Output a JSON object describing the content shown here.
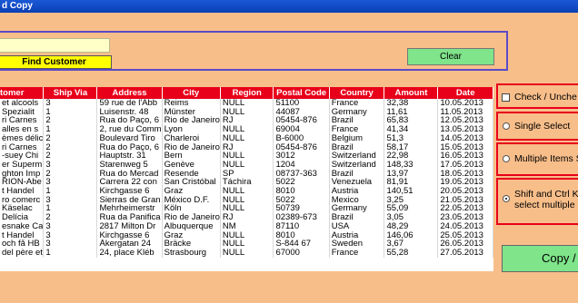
{
  "window": {
    "title": "d Copy"
  },
  "search": {
    "value": "",
    "find_label": "Find Customer",
    "clear_label": "Clear"
  },
  "table": {
    "headers": [
      "tomer",
      "Ship Via",
      "Address",
      "City",
      "Region",
      "Postal Code",
      "Country",
      "Amount",
      "Date"
    ],
    "rows": [
      [
        "et alcools",
        "3",
        "59 rue de l'Abb",
        "Reims",
        "NULL",
        "51100",
        "France",
        "32,38",
        "10.05.2013"
      ],
      [
        "Spezialit",
        "1",
        "Luisenstr. 48",
        "Münster",
        "NULL",
        "44087",
        "Germany",
        "11,61",
        "11.05.2013"
      ],
      [
        "ri Carnes",
        "2",
        "Rua do Paço, 6",
        "Rio de Janeiro",
        "RJ",
        "05454-876",
        "Brazil",
        "65,83",
        "12.05.2013"
      ],
      [
        "alles en s",
        "1",
        "2, rue du Comm",
        "Lyon",
        "NULL",
        "69004",
        "France",
        "41,34",
        "13.05.2013"
      ],
      [
        "èmes délic",
        "2",
        "Boulevard Tiro",
        "Charleroi",
        "NULL",
        "B-6000",
        "Belgium",
        "51,3",
        "14.05.2013"
      ],
      [
        "ri Carnes",
        "2",
        "Rua do Paço, 6",
        "Rio de Janeiro",
        "RJ",
        "05454-876",
        "Brazil",
        "58,17",
        "15.05.2013"
      ],
      [
        "-suey Chi",
        "2",
        "Hauptstr. 31",
        "Bern",
        "NULL",
        "3012",
        "Switzerland",
        "22,98",
        "16.05.2013"
      ],
      [
        "er Superm",
        "3",
        "Starenweg 5",
        "Genève",
        "NULL",
        "1204",
        "Switzerland",
        "148,33",
        "17.05.2013"
      ],
      [
        "ghton Imp",
        "2",
        "Rua do Mercad",
        "Resende",
        "SP",
        "08737-363",
        "Brazil",
        "13,97",
        "18.05.2013"
      ],
      [
        "RION-Abe",
        "3",
        "Carrera 22 con",
        "San Cristóbal",
        "Táchira",
        "5022",
        "Venezuela",
        "81,91",
        "19.05.2013"
      ],
      [
        "t Handel",
        "1",
        "Kirchgasse 6",
        "Graz",
        "NULL",
        "8010",
        "Austria",
        "140,51",
        "20.05.2013"
      ],
      [
        "ro comerc",
        "3",
        "Sierras de Gran",
        "México D.F.",
        "NULL",
        "5022",
        "Mexico",
        "3,25",
        "21.05.2013"
      ],
      [
        "Käselac",
        "1",
        "Mehrheimerstr",
        "Köln",
        "NULL",
        "50739",
        "Germany",
        "55,09",
        "22.05.2013"
      ],
      [
        "Delícia",
        "2",
        "Rua da Panifica",
        "Rio de Janeiro",
        "RJ",
        "02389-673",
        "Brazil",
        "3,05",
        "23.05.2013"
      ],
      [
        "esnake Ca",
        "3",
        "2817 Milton Dr",
        "Albuquerque",
        "NM",
        "87110",
        "USA",
        "48,29",
        "24.05.2013"
      ],
      [
        "t Handel",
        "3",
        "Kirchgasse 6",
        "Graz",
        "NULL",
        "8010",
        "Austria",
        "146,06",
        "25.05.2013"
      ],
      [
        "och få HB",
        "3",
        "Åkergatan 24",
        "Bräcke",
        "NULL",
        "S-844 67",
        "Sweden",
        "3,67",
        "26.05.2013"
      ],
      [
        "del père et",
        "1",
        "24, place Kléb",
        "Strasbourg",
        "NULL",
        "67000",
        "France",
        "55,28",
        "27.05.2013"
      ]
    ]
  },
  "options": {
    "checkbox_label": "Check / Unche",
    "single_select": "Single Select",
    "multiple_items": "Multiple Items S",
    "shift_ctrl_line1": "Shift and Ctrl K",
    "shift_ctrl_line2": "select multiple",
    "selected": "shift_ctrl"
  },
  "copy_label": "Copy /",
  "colors": {
    "background": "#f8be8a",
    "header": "#e8001a",
    "button_green": "#7fe48a",
    "button_yellow": "#ffff00"
  }
}
